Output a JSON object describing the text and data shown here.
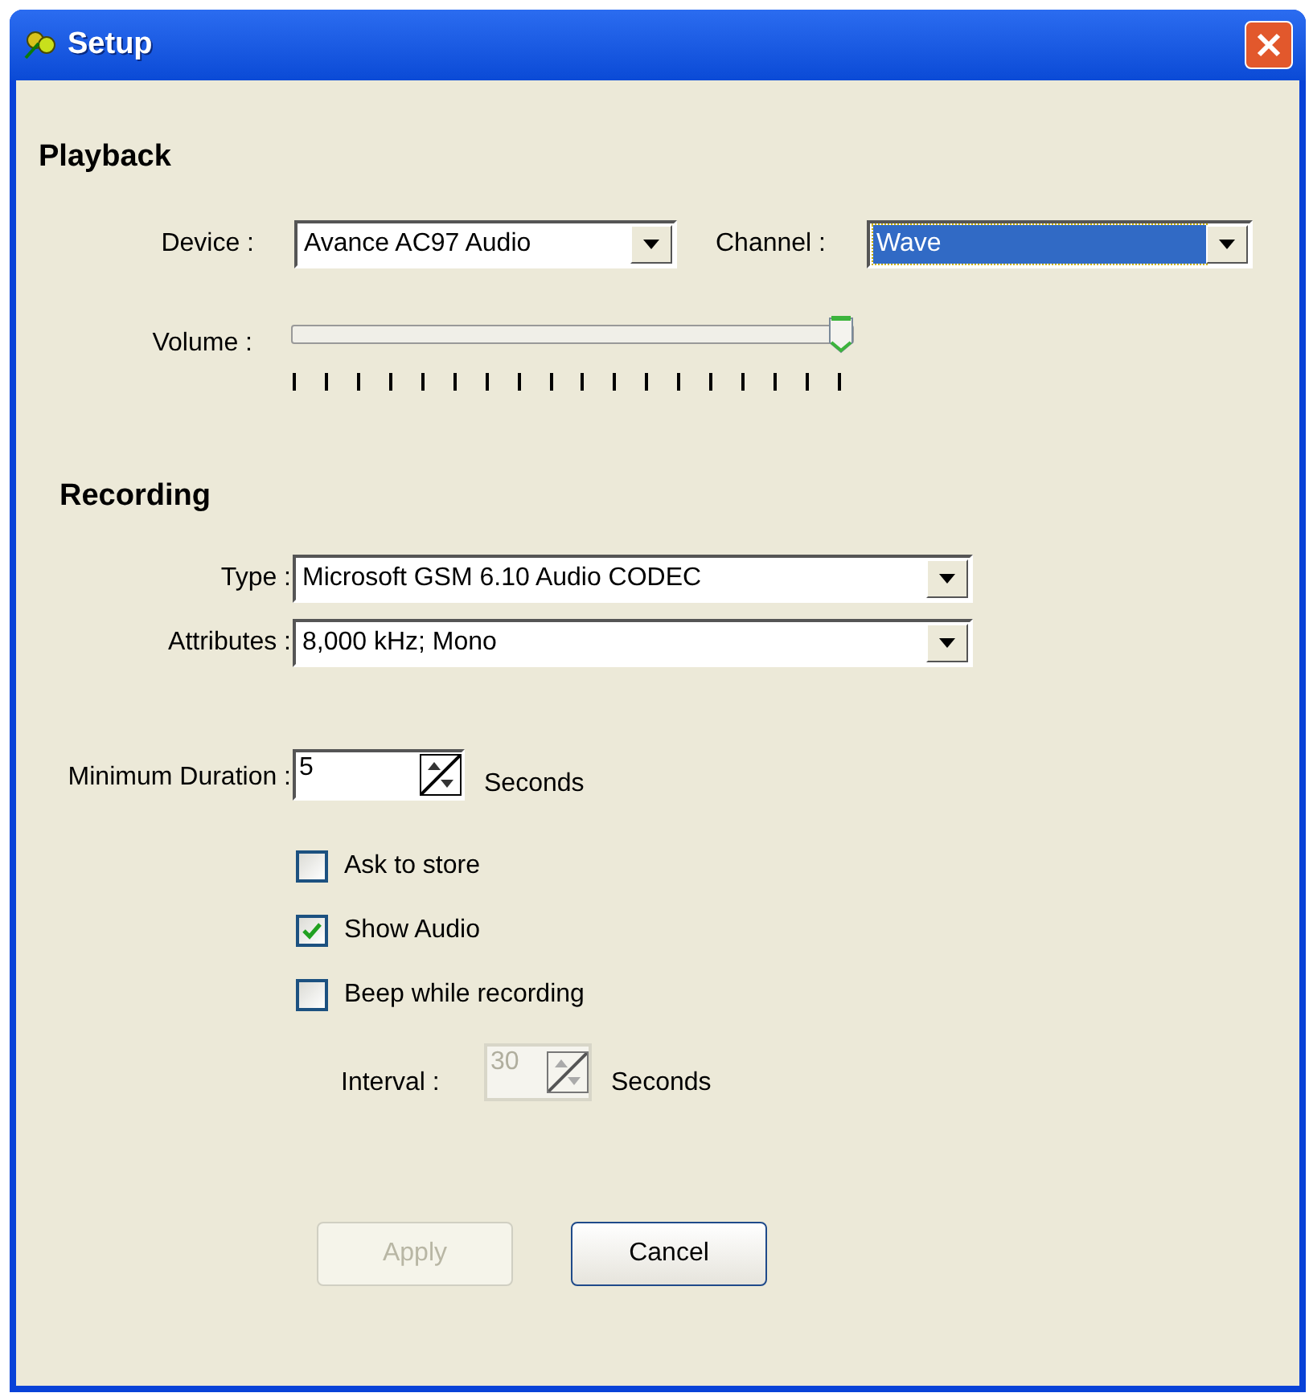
{
  "window": {
    "title": "Setup"
  },
  "playback": {
    "heading": "Playback",
    "device": {
      "label": "Device :",
      "value": "Avance AC97 Audio"
    },
    "channel": {
      "label": "Channel :",
      "value": "Wave",
      "selected": true
    },
    "volume": {
      "label": "Volume :"
    }
  },
  "recording": {
    "heading": "Recording",
    "type": {
      "label": "Type :",
      "value": "Microsoft GSM 6.10 Audio CODEC"
    },
    "attributes": {
      "label": "Attributes :",
      "value": "8,000 kHz; Mono"
    },
    "minimum_duration": {
      "label": "Minimum Duration :",
      "value": "5",
      "unit": "Seconds",
      "disabled": false
    },
    "options": [
      {
        "label": "Ask to store",
        "checked": false
      },
      {
        "label": "Show Audio",
        "checked": true
      },
      {
        "label": "Beep while recording",
        "checked": false
      }
    ],
    "interval": {
      "label": "Interval :",
      "value": "30",
      "unit": "Seconds",
      "disabled": true
    }
  },
  "buttons": [
    {
      "label": "Apply",
      "disabled": true
    },
    {
      "label": "Cancel",
      "disabled": false
    }
  ]
}
